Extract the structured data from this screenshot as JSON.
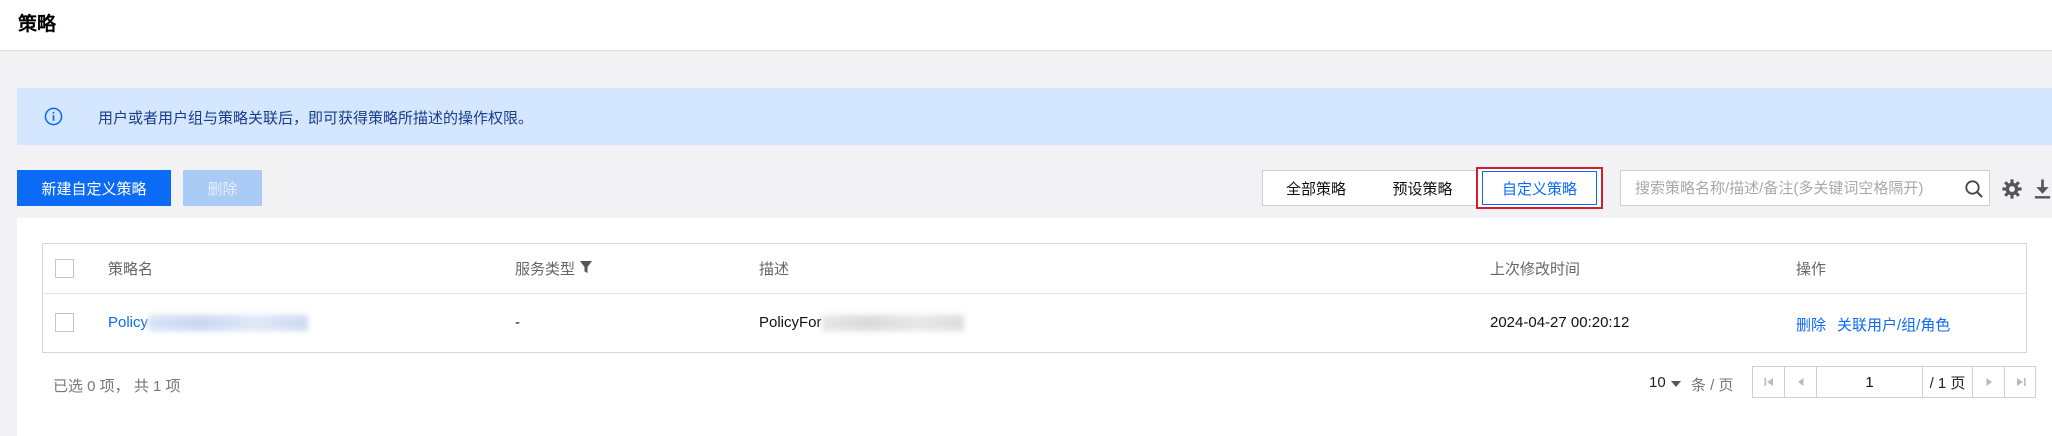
{
  "header": {
    "title": "策略"
  },
  "banner": {
    "text": "用户或者用户组与策略关联后，即可获得策略所描述的操作权限。"
  },
  "toolbar": {
    "create_label": "新建自定义策略",
    "delete_label": "删除",
    "tabs": [
      {
        "label": "全部策略",
        "selected": false
      },
      {
        "label": "预设策略",
        "selected": false
      },
      {
        "label": "自定义策略",
        "selected": true
      }
    ],
    "search_placeholder": "搜索策略名称/描述/备注(多关键词空格隔开)"
  },
  "table": {
    "columns": [
      "策略名",
      "服务类型",
      "描述",
      "上次修改时间",
      "操作"
    ],
    "rows": [
      {
        "name_prefix": "Policy",
        "service_type": "-",
        "description_prefix": "PolicyFor",
        "modified": "2024-04-27 00:20:12",
        "actions": [
          "删除",
          "关联用户/组/角色"
        ]
      }
    ]
  },
  "footer": {
    "selection_info": "已选 0 项，  共 1 项",
    "page_size": "10",
    "page_size_unit": "条 / 页",
    "current_page": "1",
    "total_pages": "/ 1 页"
  },
  "colors": {
    "primary": "#0c6bf6",
    "banner_bg": "#d5e7ff",
    "highlight_border": "#d11f2c"
  }
}
